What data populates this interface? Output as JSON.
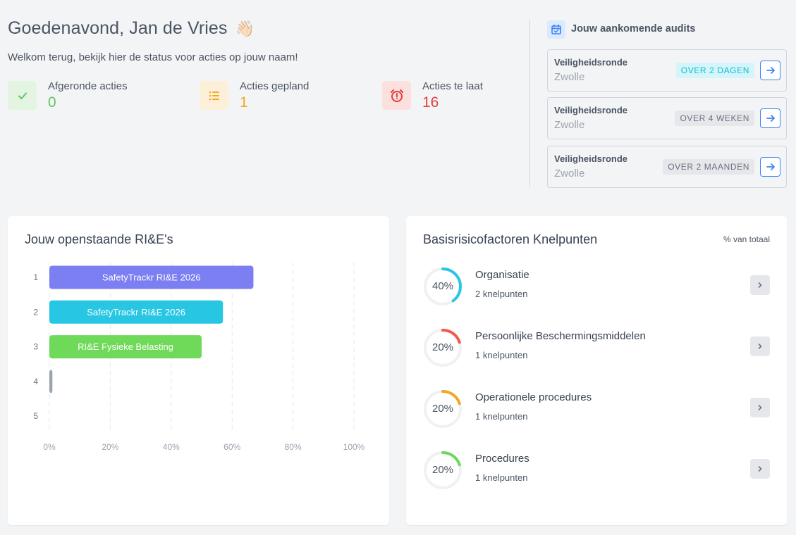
{
  "header": {
    "greeting": "Goedenavond, Jan de Vries",
    "wave_emoji": "👋🏻",
    "welcome": "Welkom terug, bekijk hier de status voor acties op jouw naam!"
  },
  "stats": [
    {
      "label": "Afgeronde acties",
      "value": "0",
      "icon": "check-icon",
      "color": "#65c466",
      "bg": "#e3f5e1"
    },
    {
      "label": "Acties gepland",
      "value": "1",
      "icon": "list-icon",
      "color": "#f5a623",
      "bg": "#fdf0d9"
    },
    {
      "label": "Acties te laat",
      "value": "16",
      "icon": "alarm-clock-icon",
      "color": "#e53e3e",
      "bg": "#fbe0de"
    }
  ],
  "audits": {
    "title": "Jouw aankomende audits",
    "icon": "calendar-check-icon",
    "items": [
      {
        "type": "Veiligheidsronde",
        "location": "Zwolle",
        "badge": "OVER 2 DAGEN",
        "badge_color": "#0fbdd6",
        "badge_bg": "#d4f5fa"
      },
      {
        "type": "Veiligheidsronde",
        "location": "Zwolle",
        "badge": "OVER 4 WEKEN",
        "badge_color": "#6b7280",
        "badge_bg": "#e5e7eb"
      },
      {
        "type": "Veiligheidsronde",
        "location": "Zwolle",
        "badge": "OVER 2 MAANDEN",
        "badge_color": "#6b7280",
        "badge_bg": "#e5e7eb"
      }
    ]
  },
  "rie_card": {
    "title": "Jouw openstaande RI&E's"
  },
  "chart_data": {
    "type": "bar",
    "orientation": "horizontal",
    "categories": [
      "1",
      "2",
      "3",
      "4",
      "5"
    ],
    "values": [
      67,
      57,
      50,
      1,
      0
    ],
    "bar_labels": [
      "SafetyTrackr RI&E 2026",
      "SafetyTrackr RI&E 2026",
      "RI&E Fysieke Belasting",
      "",
      ""
    ],
    "colors": [
      "#7b7ff2",
      "#27c6e3",
      "#6fd95a",
      "#9ca3af",
      "#9ca3af"
    ],
    "xticks": [
      "0%",
      "20%",
      "40%",
      "60%",
      "80%",
      "100%"
    ],
    "xlim": [
      0,
      100
    ],
    "grid": true
  },
  "risk_card": {
    "title": "Basisrisicofactoren Knelpunten",
    "subtitle": "% van totaal",
    "items": [
      {
        "name": "Organisatie",
        "count": "2 knelpunten",
        "percent_label": "40%",
        "percent": 40,
        "color": "#27c6e3"
      },
      {
        "name": "Persoonlijke Beschermingsmiddelen",
        "count": "1 knelpunten",
        "percent_label": "20%",
        "percent": 20,
        "color": "#ef5a4d"
      },
      {
        "name": "Operationele procedures",
        "count": "1 knelpunten",
        "percent_label": "20%",
        "percent": 20,
        "color": "#f5a623"
      },
      {
        "name": "Procedures",
        "count": "1 knelpunten",
        "percent_label": "20%",
        "percent": 20,
        "color": "#6fd95a"
      }
    ]
  }
}
